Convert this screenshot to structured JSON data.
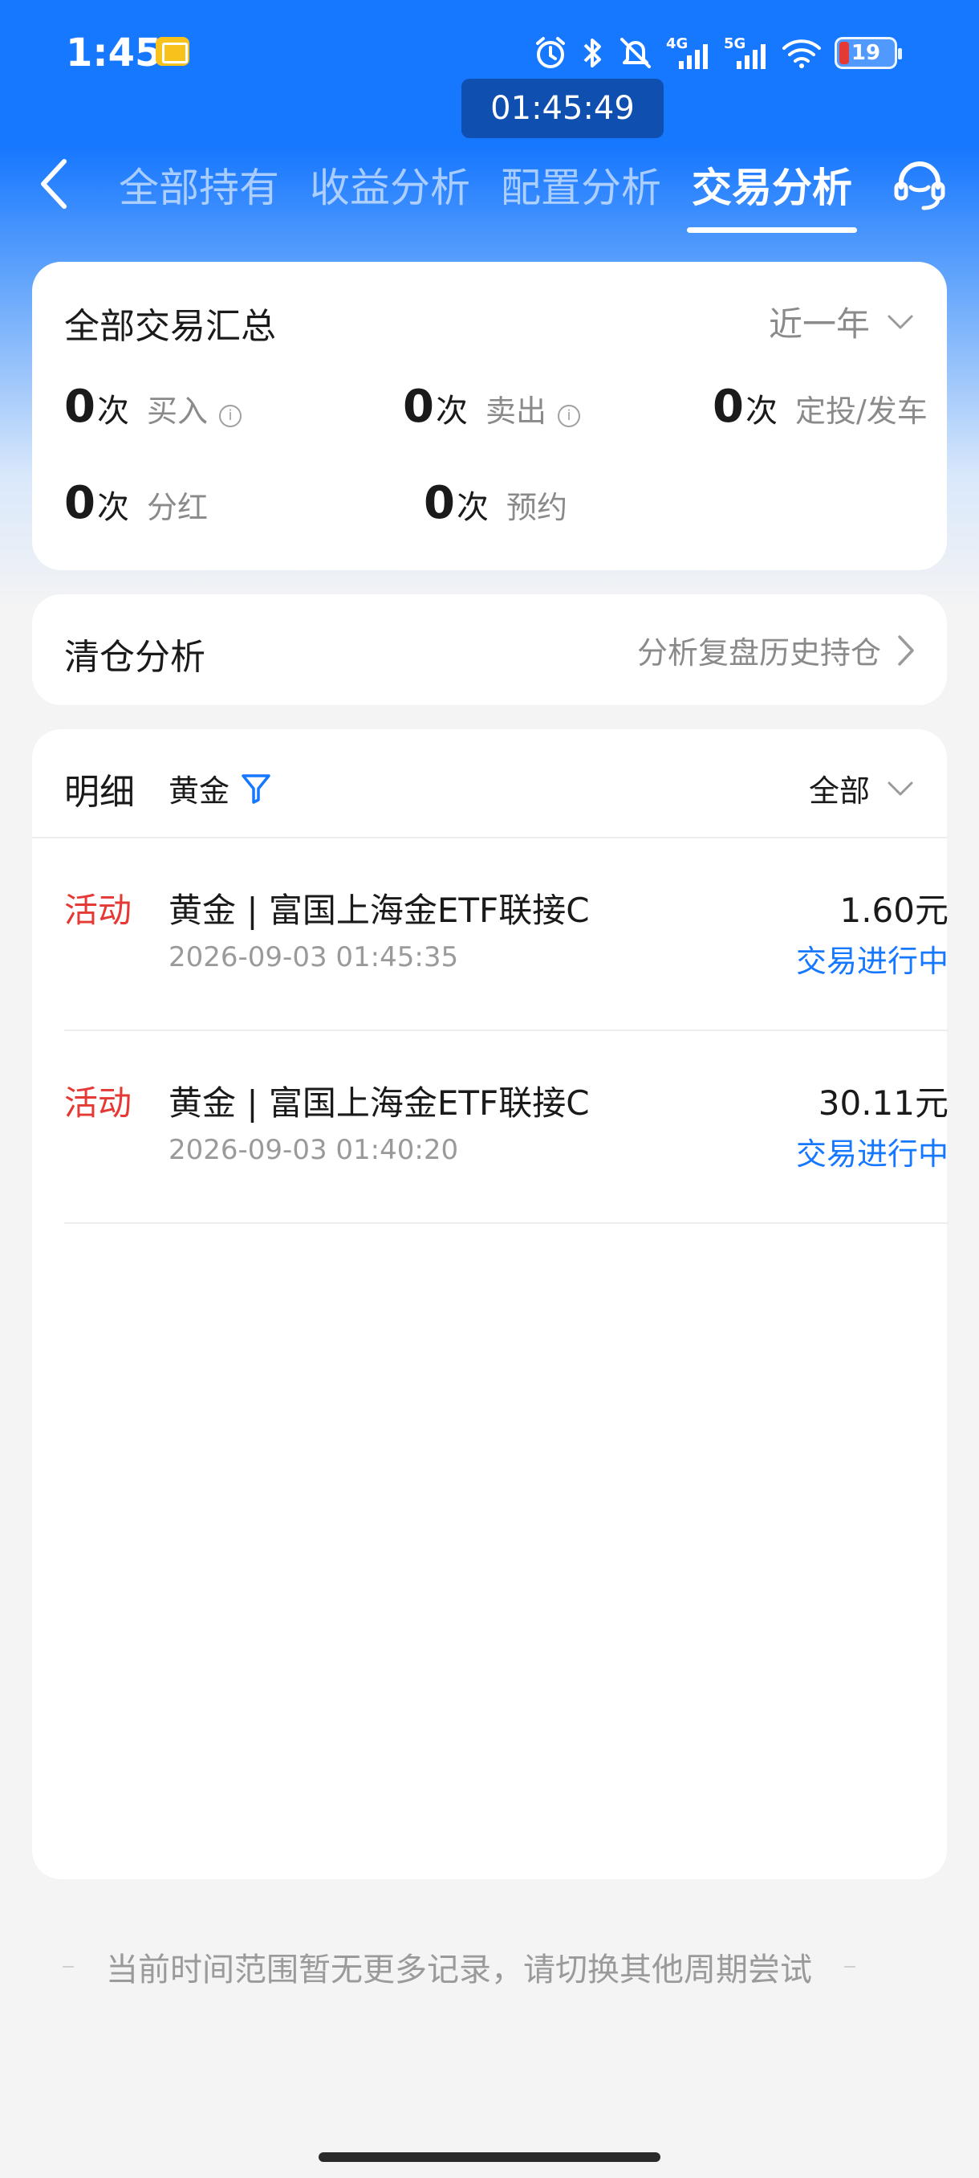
{
  "status_bar": {
    "time": "1:45",
    "battery": "19",
    "net_4g": "4G",
    "net_5g": "5G"
  },
  "screen_clock": "01:45:49",
  "nav": {
    "tabs": [
      {
        "label": "全部持有"
      },
      {
        "label": "收益分析"
      },
      {
        "label": "配置分析"
      },
      {
        "label": "交易分析"
      }
    ],
    "active_tab": "交易分析"
  },
  "summary": {
    "title": "全部交易汇总",
    "period": "近一年",
    "stats": [
      {
        "num": "0",
        "unit": "次",
        "label": "买入"
      },
      {
        "num": "0",
        "unit": "次",
        "label": "卖出"
      },
      {
        "num": "0",
        "unit": "次",
        "label": "定投/发车"
      },
      {
        "num": "0",
        "unit": "次",
        "label": "分红"
      },
      {
        "num": "0",
        "unit": "次",
        "label": "预约"
      }
    ]
  },
  "clearance": {
    "title": "清仓分析",
    "link": "分析复盘历史持仓"
  },
  "detail": {
    "title": "明细",
    "filter": "黄金",
    "scope": "全部",
    "rows": [
      {
        "tag": "活动",
        "name": "黄金 | 富国上海金ETF联接C",
        "datetime": "2026-09-03 01:45:35",
        "amount": "1.60元",
        "status": "交易进行中"
      },
      {
        "tag": "活动",
        "name": "黄金 | 富国上海金ETF联接C",
        "datetime": "2026-09-03 01:40:20",
        "amount": "30.11元",
        "status": "交易进行中"
      }
    ]
  },
  "footer": {
    "text": "当前时间范围暂无更多记录，请切换其他周期尝试"
  },
  "colors": {
    "brand_blue": "#1677ff",
    "tag_red": "#e53935",
    "link_blue": "#1677ff"
  }
}
